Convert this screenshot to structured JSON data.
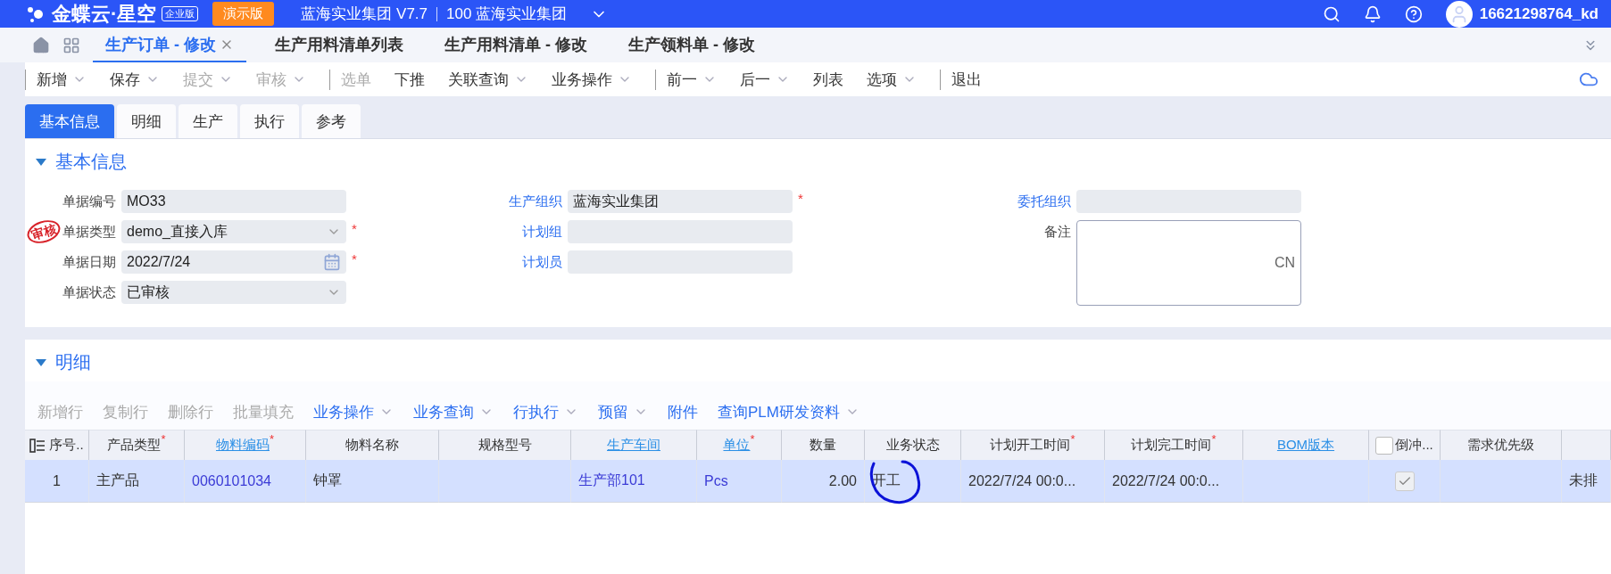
{
  "top_bar": {
    "brand": "金蝶云·星空",
    "edition": "企业版",
    "demo_badge": "演示版",
    "org_title": "蓝海实业集团 V7.7",
    "org_name": "100 蓝海实业集团",
    "user": "16621298764_kd"
  },
  "page_tabs": [
    {
      "label": "生产订单 - 修改",
      "selected": true
    },
    {
      "label": "生产用料清单列表",
      "selected": false
    },
    {
      "label": "生产用料清单 - 修改",
      "selected": false
    },
    {
      "label": "生产领料单 - 修改",
      "selected": false
    }
  ],
  "toolbar": [
    {
      "label": "新增",
      "dropdown": true,
      "disabled": false,
      "separator": true
    },
    {
      "label": "保存",
      "dropdown": true,
      "disabled": false,
      "separator": false
    },
    {
      "label": "提交",
      "dropdown": true,
      "disabled": true,
      "separator": false
    },
    {
      "label": "审核",
      "dropdown": true,
      "disabled": true,
      "separator": false
    },
    {
      "label": "选单",
      "dropdown": false,
      "disabled": true,
      "separator": true
    },
    {
      "label": "下推",
      "dropdown": false,
      "disabled": false,
      "separator": false
    },
    {
      "label": "关联查询",
      "dropdown": true,
      "disabled": false,
      "separator": false
    },
    {
      "label": "业务操作",
      "dropdown": true,
      "disabled": false,
      "separator": false
    },
    {
      "label": "前一",
      "dropdown": true,
      "disabled": false,
      "separator": true
    },
    {
      "label": "后一",
      "dropdown": true,
      "disabled": false,
      "separator": false
    },
    {
      "label": "列表",
      "dropdown": false,
      "disabled": false,
      "separator": false
    },
    {
      "label": "选项",
      "dropdown": true,
      "disabled": false,
      "separator": false
    },
    {
      "label": "退出",
      "dropdown": false,
      "disabled": false,
      "separator": true
    }
  ],
  "form_tabs": [
    {
      "label": "基本信息",
      "selected": true
    },
    {
      "label": "明细",
      "selected": false
    },
    {
      "label": "生产",
      "selected": false
    },
    {
      "label": "执行",
      "selected": false
    },
    {
      "label": "参考",
      "selected": false
    }
  ],
  "basic_info": {
    "title": "基本信息",
    "expanded": true,
    "stamp": "审核",
    "columns": [
      [
        {
          "label": "单据编号",
          "value": "MO33",
          "kind": "text",
          "link": false
        },
        {
          "label": "单据类型",
          "value": "demo_直接入库",
          "kind": "select",
          "link": false,
          "required_mark": "*"
        },
        {
          "label": "单据日期",
          "value": "2022/7/24",
          "kind": "date",
          "link": false,
          "required_mark": "*"
        },
        {
          "label": "单据状态",
          "value": "已审核",
          "kind": "select",
          "link": false
        }
      ],
      [
        {
          "label": "生产组织",
          "value": "蓝海实业集团",
          "kind": "text",
          "link": true,
          "required_mark": "*"
        },
        {
          "label": "计划组",
          "kind": "text",
          "link": true
        },
        {
          "label": "计划员",
          "kind": "text",
          "link": true
        }
      ],
      [
        {
          "label": "委托组织",
          "kind": "text",
          "link": true
        },
        {
          "label": "备注",
          "kind": "textarea",
          "link": false,
          "lang": "CN"
        }
      ]
    ]
  },
  "detail": {
    "title": "明细",
    "expanded": true,
    "toolbar": [
      {
        "label": "新增行",
        "dropdown": false,
        "disabled": true
      },
      {
        "label": "复制行",
        "dropdown": false,
        "disabled": true
      },
      {
        "label": "删除行",
        "dropdown": false,
        "disabled": true
      },
      {
        "label": "批量填充",
        "dropdown": false,
        "disabled": true
      },
      {
        "label": "业务操作",
        "dropdown": true,
        "disabled": false
      },
      {
        "label": "业务查询",
        "dropdown": true,
        "disabled": false
      },
      {
        "label": "行执行",
        "dropdown": true,
        "disabled": false
      },
      {
        "label": "预留",
        "dropdown": true,
        "disabled": false
      },
      {
        "label": "附件",
        "dropdown": false,
        "disabled": false
      },
      {
        "label": "查询PLM研发资料",
        "dropdown": true,
        "disabled": false
      }
    ],
    "columns": [
      {
        "label": "序号..",
        "link": false,
        "kind": "index"
      },
      {
        "label": "产品类型",
        "link": false,
        "required_mark": "*",
        "kind": "text"
      },
      {
        "label": "物料编码",
        "link": true,
        "required_mark": "*",
        "kind": "text"
      },
      {
        "label": "物料名称",
        "link": false,
        "kind": "text"
      },
      {
        "label": "规格型号",
        "link": false,
        "kind": "text"
      },
      {
        "label": "生产车间",
        "link": true,
        "kind": "text"
      },
      {
        "label": "单位",
        "link": true,
        "required_mark": "*",
        "kind": "text"
      },
      {
        "label": "数量",
        "link": false,
        "kind": "number"
      },
      {
        "label": "业务状态",
        "link": false,
        "kind": "text"
      },
      {
        "label": "计划开工时间",
        "link": false,
        "required_mark": "*",
        "kind": "text"
      },
      {
        "label": "计划完工时间",
        "link": false,
        "required_mark": "*",
        "kind": "text"
      },
      {
        "label": "BOM版本",
        "link": true,
        "kind": "text"
      },
      {
        "label": "倒冲...",
        "link": false,
        "kind": "check"
      },
      {
        "label": "需求优先级",
        "link": false,
        "kind": "text"
      },
      {
        "kind": "text"
      }
    ],
    "rows": [
      {
        "selected": true,
        "header_checked": false,
        "cells": [
          {
            "text": "1"
          },
          {
            "text": "主产品"
          },
          {
            "text": "0060101034",
            "link": true
          },
          {
            "text": "钟罩"
          },
          {},
          {
            "text": "生产部101",
            "link": true
          },
          {
            "text": "Pcs",
            "link": true
          },
          {
            "text": "2.00"
          },
          {
            "text": "开工",
            "circled": true
          },
          {
            "text": "2022/7/24 00:0..."
          },
          {
            "text": "2022/7/24 00:0..."
          },
          {},
          {
            "checked": true
          },
          {},
          {
            "text": "未排"
          }
        ]
      }
    ]
  }
}
